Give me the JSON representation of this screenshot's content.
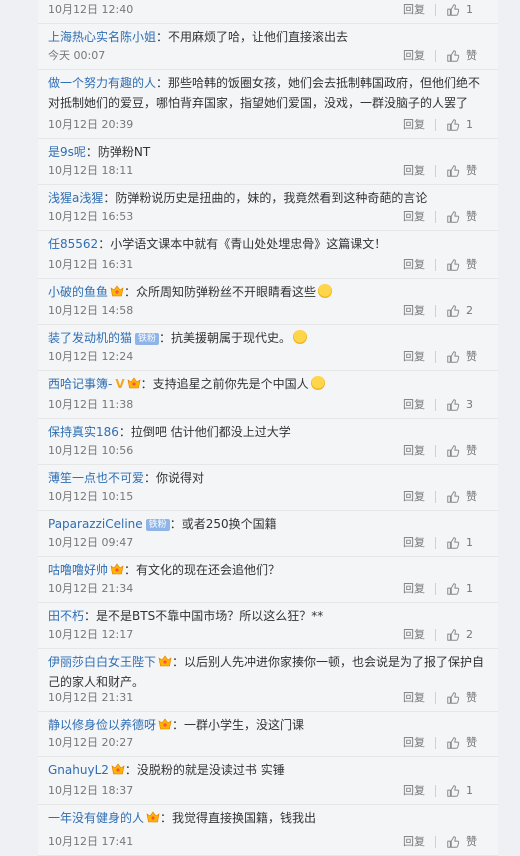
{
  "ui": {
    "reply_label": "回复",
    "like_label": "赞"
  },
  "comments": [
    {
      "user": "",
      "text": "",
      "time": "10月12日 12:40",
      "likes": "1"
    },
    {
      "user": "上海热心实名陈小姐",
      "text": "：不用麻烦了哈，让他们直接滚出去",
      "time": "今天 00:07",
      "likes": "赞"
    },
    {
      "user": "做一个努力有趣的人",
      "text": "：那些哈韩的饭圈女孩，她们会去抵制韩国政府，但他们绝不对抵制她们的爱豆，哪怕背弃国家，指望她们爱国，没戏，一群没脑子的人罢了",
      "time": "10月12日 20:39",
      "likes": "1"
    },
    {
      "user": "是9s呢",
      "text": "：防弹粉NT",
      "time": "10月12日 18:11",
      "likes": "赞"
    },
    {
      "user": "浅猩a浅猩",
      "text": "：防弹粉说历史是扭曲的，妹的，我竟然看到这种奇葩的言论",
      "time": "10月12日 16:53",
      "likes": "赞"
    },
    {
      "user": "任85562",
      "text": "：小学语文课本中就有《青山处处埋忠骨》这篇课文！",
      "time": "10月12日 16:31",
      "likes": "赞"
    },
    {
      "user": "小破的鱼鱼",
      "text": "：众所周知防弹粉丝不开眼睛看这些",
      "time": "10月12日 14:58",
      "likes": "2"
    },
    {
      "user": "装了发动机的猫",
      "text": "：抗美援朝属于现代史。",
      "time": "10月12日 12:24",
      "likes": "赞",
      "badge": "铁粉"
    },
    {
      "user": "西哈记事簿-",
      "text": "：支持追星之前你先是个中国人",
      "time": "10月12日 11:38",
      "likes": "3"
    },
    {
      "user": "保持真实186",
      "text": "：拉倒吧 估计他们都没上过大学",
      "time": "10月12日 10:56",
      "likes": "赞"
    },
    {
      "user": "薄笙一点也不可爱",
      "text": "：你说得对",
      "time": "10月12日 10:15",
      "likes": "赞"
    },
    {
      "user": "PaparazziCeline",
      "text": "：或者250换个国籍",
      "time": "10月12日 09:47",
      "likes": "1",
      "badge": "铁粉"
    },
    {
      "user": "咕噜噜好帅",
      "text": "：有文化的现在还会追他们？",
      "time": "10月12日 21:34",
      "likes": "1"
    },
    {
      "user": "田不朽",
      "text": "：是不是BTS不靠中国市场？所以这么狂？**",
      "time": "10月12日 12:17",
      "likes": "2"
    },
    {
      "user": "伊丽莎白白女王陛下",
      "text": "：以后别人先冲进你家揍你一顿，也会说是为了报了保护自己的家人和财产。",
      "time": "10月12日 21:31",
      "likes": "赞"
    },
    {
      "user": "静以修身俭以养德呀",
      "text": "：一群小学生，没这门课",
      "time": "10月12日 20:27",
      "likes": "赞"
    },
    {
      "user": "GnahuyL2",
      "text": "：没脱粉的就是没读过书 实锤",
      "time": "10月12日 18:37",
      "likes": "1"
    },
    {
      "user": "一年没有健身的人",
      "text": "：我觉得直接换国籍，钱我出",
      "time": "10月12日 17:41",
      "likes": "赞"
    }
  ]
}
